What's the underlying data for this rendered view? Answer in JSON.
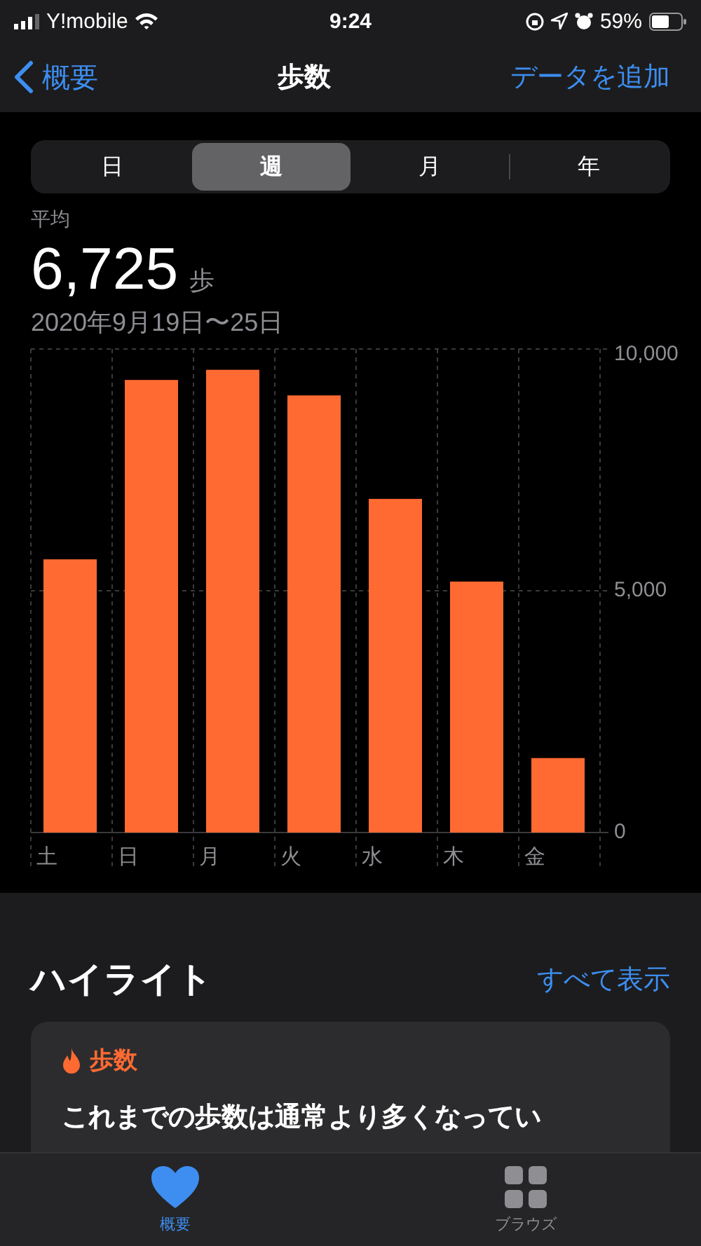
{
  "status_bar": {
    "carrier": "Y!mobile",
    "time": "9:24",
    "battery": "59%"
  },
  "nav": {
    "back": "概要",
    "title": "歩数",
    "action": "データを追加"
  },
  "segments": [
    {
      "label": "日",
      "selected": false
    },
    {
      "label": "週",
      "selected": true
    },
    {
      "label": "月",
      "selected": false
    },
    {
      "label": "年",
      "selected": false
    }
  ],
  "summary": {
    "label": "平均",
    "value": "6,725",
    "unit": "歩",
    "range": "2020年9月19日〜25日"
  },
  "chart_data": {
    "type": "bar",
    "categories": [
      "土",
      "日",
      "月",
      "火",
      "水",
      "木",
      "金"
    ],
    "series": [
      {
        "color": "#ff6a33",
        "values": [
          5650,
          9360,
          9570,
          9040,
          6900,
          5190,
          1540
        ]
      }
    ],
    "ylim": [
      0,
      10000
    ],
    "yticks": [
      {
        "value": 0,
        "label": "0"
      },
      {
        "value": 5000,
        "label": "5,000"
      },
      {
        "value": 10000,
        "label": "10,000"
      }
    ]
  },
  "highlights": {
    "title": "ハイライト",
    "link": "すべて表示",
    "card": {
      "category": "歩数",
      "text": "これまでの歩数は通常より多くなってい"
    }
  },
  "tab_bar": [
    {
      "label": "概要",
      "selected": true,
      "kind": "summary"
    },
    {
      "label": "ブラウズ",
      "selected": false,
      "kind": "browse"
    }
  ]
}
